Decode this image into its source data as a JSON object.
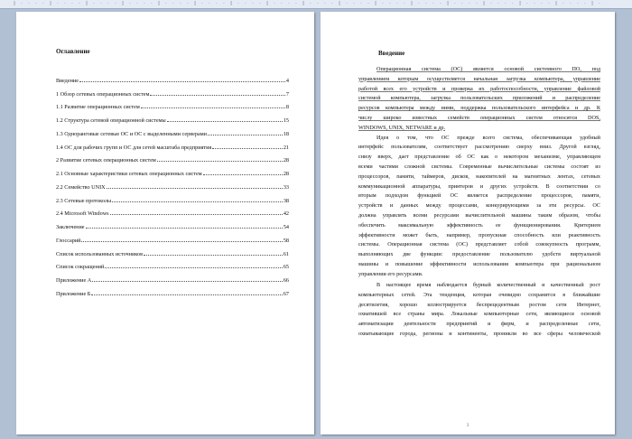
{
  "toc": {
    "title": "Оглавление",
    "items": [
      {
        "label": "Введение",
        "page": "4"
      },
      {
        "label": "1 Обзор сетевых операционных систем",
        "page": "7"
      },
      {
        "label": "1.1 Развитие операционных систем",
        "page": "8"
      },
      {
        "label": "1.2 Структура сетевой операционной системы",
        "page": "15"
      },
      {
        "label": "1.3 Одноранговые сетевые ОС и ОС с выделенными серверами",
        "page": "18"
      },
      {
        "label": "1.4 ОС для рабочих групп и ОС для сетей масштаба предприятия",
        "page": "21"
      },
      {
        "label": "2 Развитие сетевых операционных систем",
        "page": "28"
      },
      {
        "label": "2.1 Основные характеристики сетевых операционных систем",
        "page": "28"
      },
      {
        "label": "2.2 Семейство UNIX",
        "page": "33"
      },
      {
        "label": "2.3 Сетевые протоколы",
        "page": "38"
      },
      {
        "label": "2.4 Microsoft Windows",
        "page": "42"
      },
      {
        "label": "Заключение",
        "page": "54"
      },
      {
        "label": "Глоссарий",
        "page": "58"
      },
      {
        "label": "Список использованных источников",
        "page": "61"
      },
      {
        "label": "Список сокращений",
        "page": "65"
      },
      {
        "label": "Приложение А",
        "page": "66"
      },
      {
        "label": "Приложение Б",
        "page": "67"
      }
    ]
  },
  "intro": {
    "title": "Введение",
    "lines": [
      "Операционная система (ОС) является основой системного ПО, под",
      "управлением которым осуществляется начальная загрузка компьютера, управление",
      "работой всех его устройств и проверка их работоспособности, управление файловой",
      "системой компьютера, загрузка пользовательских приложений и распределение",
      "ресурсов компьютера между ними, поддержка пользовательского интерфейса и др. К",
      "числу широко известных семейств операционных систем относятся DOS,",
      "WINDOWS, UNIX, NETWARE и др.",
      "Идея о том, что ОС прежде всего система, обеспечивающая удобный",
      "интерфейс пользователям, соответствует рассмотрению сверху вниз. Другой взгляд,",
      "снизу вверх, дает представление об ОС как о некотором механизме, управляющем",
      "всеми частями сложной системы. Современные вычислительные системы состоят из",
      "процессоров, памяти, таймеров, дисков, накопителей на магнитных лентах, сетевых",
      "коммуникационной аппаратуры, принтеров и других устройств. В соответствии со",
      "вторым подходом функцией ОС является распределение процессоров, памяти,",
      "устройств и данных между процессами, конкурирующими за эти ресурсы. ОС",
      "должна управлять всеми ресурсами вычислительной машины таким образом, чтобы",
      "обеспечить максимальную эффективность ее функционирования. Критерием",
      "эффективности может быть, например, пропускная способность или реактивность",
      "системы. Операционная система (ОС) представляет собой совокупность программ,",
      "выполняющих две функции: предоставление пользователю удобств виртуальной",
      "машины и повышение эффективности использования компьютера при рациональном",
      "управлении его ресурсами.",
      "В настоящее время наблюдается бурный количественный и качественный рост",
      "компьютерных сетей. Эта тенденция, которая очевидно сохранится в ближайшие",
      "десятилетия, хорошо иллюстрируется беспрецедентным ростом сети Интернет,",
      "охватившей все страны мира. Локальные компьютерные сети, являющиеся основой",
      "автоматизации деятельности предприятий и фирм, и распределенные сети,",
      "охватывающие города, регионы и континенты, проникли во все сферы человеческой"
    ]
  },
  "page_number": "3"
}
